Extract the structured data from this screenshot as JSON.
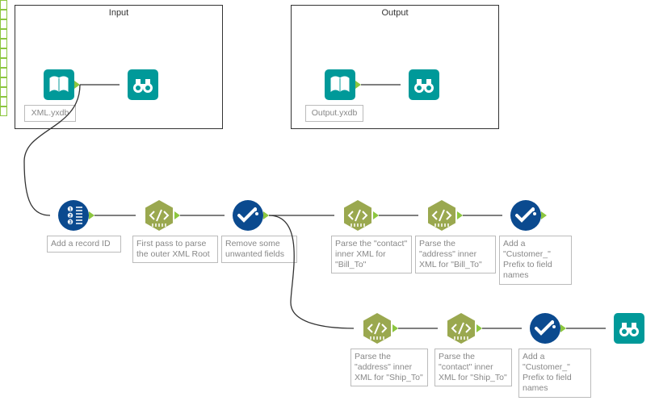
{
  "containers": {
    "input": {
      "title": "Input",
      "file_label": "XML.yxdb"
    },
    "output": {
      "title": "Output",
      "file_label": "Output.yxdb"
    }
  },
  "row1": {
    "n1": "Add a record ID",
    "n2": "First pass to parse the outer XML Root",
    "n3": "Remove some unwanted fields",
    "n4": "Parse the \"contact\" inner XML for \"Bill_To\"",
    "n5": "Parse the \"address\" inner XML for \"Bill_To\"",
    "n6": "Add a \"Customer_\" Prefix to field names"
  },
  "row2": {
    "n1": "Parse the \"address\" inner XML for \"Ship_To\"",
    "n2": "Parse the \"contact\" inner XML for \"Ship_To\"",
    "n3": "Add a \"Customer_\" Prefix to field names"
  }
}
